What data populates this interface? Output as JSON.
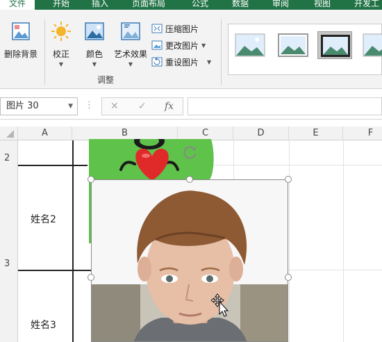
{
  "ribbon_tabs": [
    "文件",
    "开始",
    "插入",
    "页面布局",
    "公式",
    "数据",
    "审阅",
    "视图",
    "开发工"
  ],
  "ribbon": {
    "remove_bg": "删除背景",
    "correct": "校正",
    "color": "颜色",
    "art_effects": "艺术效果",
    "compress": "压缩图片",
    "change": "更改图片",
    "reset": "重设图片",
    "group_label": "调整"
  },
  "formula_bar": {
    "name_box": "图片 30",
    "cancel_icon": "✕",
    "enter_icon": "✓",
    "fx": "fx",
    "value": ""
  },
  "columns": [
    "A",
    "B",
    "C",
    "D",
    "E",
    "F"
  ],
  "rows": [
    "2",
    "3"
  ],
  "cells": {
    "a_row2": "姓名2",
    "a_row3": "姓名3"
  },
  "colors": {
    "accent": "#217346",
    "frog_green": "#5fc24a",
    "heart_red": "#e02a2a"
  }
}
